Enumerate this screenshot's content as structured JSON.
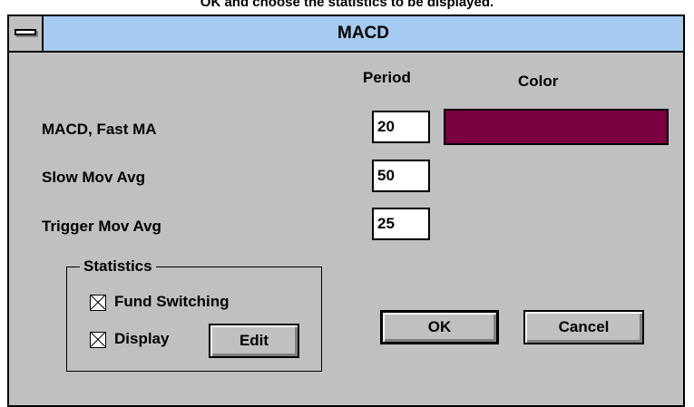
{
  "top_caption": "OK and choose the statistics to be displayed.",
  "window": {
    "title": "MACD",
    "sysmenu_icon": "system-menu-icon"
  },
  "headers": {
    "period": "Period",
    "color": "Color"
  },
  "rows": [
    {
      "label": "MACD, Fast MA",
      "value": "20"
    },
    {
      "label": "Slow Mov Avg",
      "value": "50"
    },
    {
      "label": "Trigger Mov Avg",
      "value": "25"
    }
  ],
  "color_swatch": "#7a0040",
  "statistics": {
    "title": "Statistics",
    "fund_switching": {
      "label": "Fund Switching",
      "checked": true
    },
    "display": {
      "label": "Display",
      "checked": true
    },
    "edit_label": "Edit"
  },
  "buttons": {
    "ok": "OK",
    "cancel": "Cancel"
  },
  "colors": {
    "face": "#c0c0c0",
    "titlebar": "#a6caf0"
  }
}
